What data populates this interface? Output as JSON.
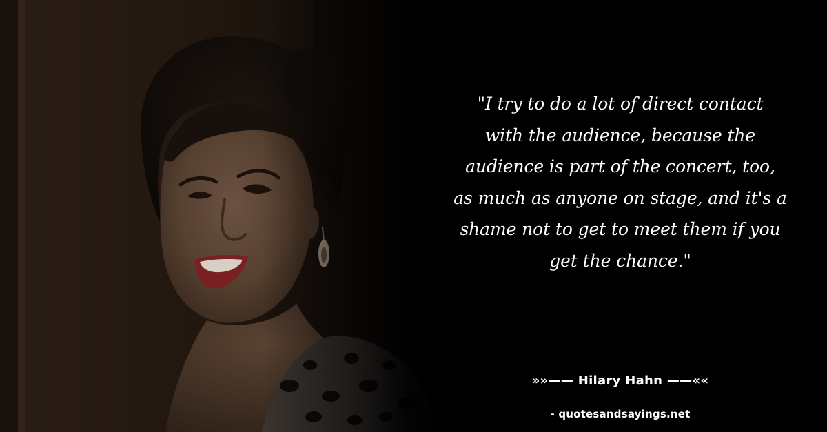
{
  "quote": {
    "text": "\"I try to do a lot of direct contact\nwith the audience, because the\naudience is part of the concert, too,\nas much as anyone on stage, and it's a\nshame not to get to meet them if you\nget the chance.\"",
    "author_line": "»»—— Hilary Hahn ——««",
    "source": "- quotesandsayings.net"
  },
  "colors": {
    "background": "#000000",
    "text": "#ffffff",
    "lips": "#7a1f22"
  }
}
